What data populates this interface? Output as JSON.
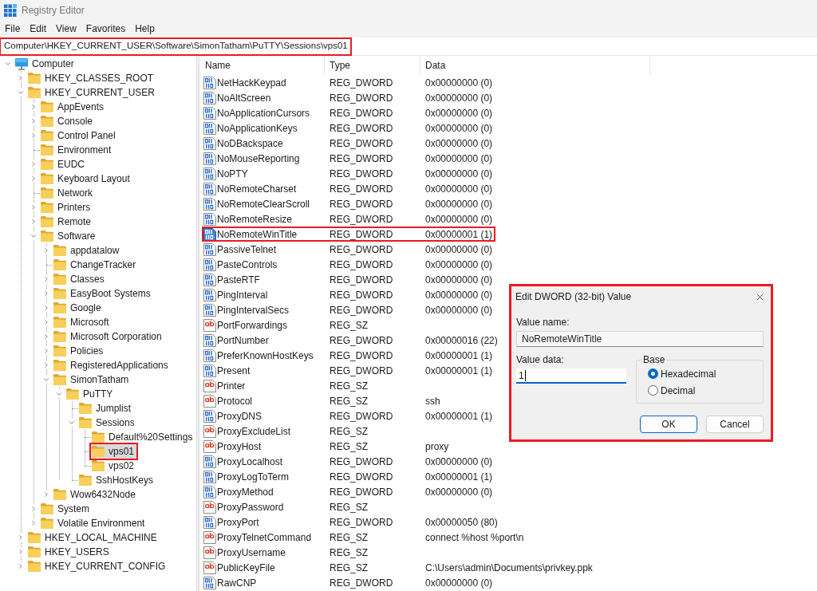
{
  "window": {
    "title": "Registry Editor"
  },
  "menu": [
    "File",
    "Edit",
    "View",
    "Favorites",
    "Help"
  ],
  "address_bar": {
    "path": "Computer\\HKEY_CURRENT_USER\\Software\\SimonTatham\\PuTTY\\Sessions\\vps01",
    "highlighted": true
  },
  "tree": {
    "root": {
      "label": "Computer",
      "kind": "expanded",
      "selected": false,
      "highlighted": false,
      "children": [
        {
          "label": "HKEY_CLASSES_ROOT",
          "kind": "collapsed",
          "selected": false,
          "highlighted": false
        },
        {
          "label": "HKEY_CURRENT_USER",
          "kind": "expanded",
          "selected": false,
          "highlighted": false,
          "children": [
            {
              "label": "AppEvents",
              "kind": "collapsed",
              "selected": false,
              "highlighted": false
            },
            {
              "label": "Console",
              "kind": "collapsed",
              "selected": false,
              "highlighted": false
            },
            {
              "label": "Control Panel",
              "kind": "collapsed",
              "selected": false,
              "highlighted": false
            },
            {
              "label": "Environment",
              "kind": "leaf",
              "selected": false,
              "highlighted": false
            },
            {
              "label": "EUDC",
              "kind": "collapsed",
              "selected": false,
              "highlighted": false
            },
            {
              "label": "Keyboard Layout",
              "kind": "collapsed",
              "selected": false,
              "highlighted": false
            },
            {
              "label": "Network",
              "kind": "leaf",
              "selected": false,
              "highlighted": false
            },
            {
              "label": "Printers",
              "kind": "collapsed",
              "selected": false,
              "highlighted": false
            },
            {
              "label": "Remote",
              "kind": "collapsed",
              "selected": false,
              "highlighted": false
            },
            {
              "label": "Software",
              "kind": "expanded",
              "selected": false,
              "highlighted": false,
              "children": [
                {
                  "label": "appdatalow",
                  "kind": "collapsed",
                  "selected": false,
                  "highlighted": false
                },
                {
                  "label": "ChangeTracker",
                  "kind": "leaf",
                  "selected": false,
                  "highlighted": false
                },
                {
                  "label": "Classes",
                  "kind": "collapsed",
                  "selected": false,
                  "highlighted": false
                },
                {
                  "label": "EasyBoot Systems",
                  "kind": "collapsed",
                  "selected": false,
                  "highlighted": false
                },
                {
                  "label": "Google",
                  "kind": "collapsed",
                  "selected": false,
                  "highlighted": false
                },
                {
                  "label": "Microsoft",
                  "kind": "collapsed",
                  "selected": false,
                  "highlighted": false
                },
                {
                  "label": "Microsoft Corporation",
                  "kind": "collapsed",
                  "selected": false,
                  "highlighted": false
                },
                {
                  "label": "Policies",
                  "kind": "collapsed",
                  "selected": false,
                  "highlighted": false
                },
                {
                  "label": "RegisteredApplications",
                  "kind": "collapsed",
                  "selected": false,
                  "highlighted": false
                },
                {
                  "label": "SimonTatham",
                  "kind": "expanded",
                  "selected": false,
                  "highlighted": false,
                  "children": [
                    {
                      "label": "PuTTY",
                      "kind": "expanded",
                      "selected": false,
                      "highlighted": false,
                      "children": [
                        {
                          "label": "Jumplist",
                          "kind": "leaf",
                          "selected": false,
                          "highlighted": false
                        },
                        {
                          "label": "Sessions",
                          "kind": "expanded",
                          "selected": false,
                          "highlighted": false,
                          "children": [
                            {
                              "label": "Default%20Settings",
                              "kind": "leaf",
                              "selected": false,
                              "highlighted": false
                            },
                            {
                              "label": "vps01",
                              "kind": "leaf",
                              "selected": true,
                              "highlighted": true
                            },
                            {
                              "label": "vps02",
                              "kind": "leaf",
                              "selected": false,
                              "highlighted": false
                            }
                          ]
                        },
                        {
                          "label": "SshHostKeys",
                          "kind": "leaf",
                          "selected": false,
                          "highlighted": false
                        }
                      ]
                    }
                  ]
                },
                {
                  "label": "Wow6432Node",
                  "kind": "collapsed",
                  "selected": false,
                  "highlighted": false
                }
              ]
            },
            {
              "label": "System",
              "kind": "collapsed",
              "selected": false,
              "highlighted": false
            },
            {
              "label": "Volatile Environment",
              "kind": "collapsed",
              "selected": false,
              "highlighted": false
            }
          ]
        },
        {
          "label": "HKEY_LOCAL_MACHINE",
          "kind": "collapsed",
          "selected": false,
          "highlighted": false
        },
        {
          "label": "HKEY_USERS",
          "kind": "collapsed",
          "selected": false,
          "highlighted": false
        },
        {
          "label": "HKEY_CURRENT_CONFIG",
          "kind": "collapsed",
          "selected": false,
          "highlighted": false
        }
      ]
    }
  },
  "list": {
    "columns": [
      "Name",
      "Type",
      "Data"
    ],
    "rows": [
      {
        "kind": "dword",
        "name": "NetHackKeypad",
        "type": "REG_DWORD",
        "data": "0x00000000 (0)",
        "selected": false,
        "highlighted": false
      },
      {
        "kind": "dword",
        "name": "NoAltScreen",
        "type": "REG_DWORD",
        "data": "0x00000000 (0)",
        "selected": false,
        "highlighted": false
      },
      {
        "kind": "dword",
        "name": "NoApplicationCursors",
        "type": "REG_DWORD",
        "data": "0x00000000 (0)",
        "selected": false,
        "highlighted": false
      },
      {
        "kind": "dword",
        "name": "NoApplicationKeys",
        "type": "REG_DWORD",
        "data": "0x00000000 (0)",
        "selected": false,
        "highlighted": false
      },
      {
        "kind": "dword",
        "name": "NoDBackspace",
        "type": "REG_DWORD",
        "data": "0x00000000 (0)",
        "selected": false,
        "highlighted": false
      },
      {
        "kind": "dword",
        "name": "NoMouseReporting",
        "type": "REG_DWORD",
        "data": "0x00000000 (0)",
        "selected": false,
        "highlighted": false
      },
      {
        "kind": "dword",
        "name": "NoPTY",
        "type": "REG_DWORD",
        "data": "0x00000000 (0)",
        "selected": false,
        "highlighted": false
      },
      {
        "kind": "dword",
        "name": "NoRemoteCharset",
        "type": "REG_DWORD",
        "data": "0x00000000 (0)",
        "selected": false,
        "highlighted": false
      },
      {
        "kind": "dword",
        "name": "NoRemoteClearScroll",
        "type": "REG_DWORD",
        "data": "0x00000000 (0)",
        "selected": false,
        "highlighted": false
      },
      {
        "kind": "dword",
        "name": "NoRemoteResize",
        "type": "REG_DWORD",
        "data": "0x00000000 (0)",
        "selected": false,
        "highlighted": false
      },
      {
        "kind": "dword",
        "name": "NoRemoteWinTitle",
        "type": "REG_DWORD",
        "data": "0x00000001 (1)",
        "selected": true,
        "highlighted": true
      },
      {
        "kind": "dword",
        "name": "PassiveTelnet",
        "type": "REG_DWORD",
        "data": "0x00000000 (0)",
        "selected": false,
        "highlighted": false
      },
      {
        "kind": "dword",
        "name": "PasteControls",
        "type": "REG_DWORD",
        "data": "0x00000000 (0)",
        "selected": false,
        "highlighted": false
      },
      {
        "kind": "dword",
        "name": "PasteRTF",
        "type": "REG_DWORD",
        "data": "0x00000000 (0)",
        "selected": false,
        "highlighted": false
      },
      {
        "kind": "dword",
        "name": "PingInterval",
        "type": "REG_DWORD",
        "data": "0x00000000 (0)",
        "selected": false,
        "highlighted": false
      },
      {
        "kind": "dword",
        "name": "PingIntervalSecs",
        "type": "REG_DWORD",
        "data": "0x00000000 (0)",
        "selected": false,
        "highlighted": false
      },
      {
        "kind": "string",
        "name": "PortForwardings",
        "type": "REG_SZ",
        "selected": false,
        "highlighted": false
      },
      {
        "kind": "dword",
        "name": "PortNumber",
        "type": "REG_DWORD",
        "data": "0x00000016 (22)",
        "selected": false,
        "highlighted": false
      },
      {
        "kind": "dword",
        "name": "PreferKnownHostKeys",
        "type": "REG_DWORD",
        "data": "0x00000001 (1)",
        "selected": false,
        "highlighted": false
      },
      {
        "kind": "dword",
        "name": "Present",
        "type": "REG_DWORD",
        "data": "0x00000001 (1)",
        "selected": false,
        "highlighted": false
      },
      {
        "kind": "string",
        "name": "Printer",
        "type": "REG_SZ",
        "selected": false,
        "highlighted": false
      },
      {
        "kind": "string",
        "name": "Protocol",
        "type": "REG_SZ",
        "data": "ssh",
        "selected": false,
        "highlighted": false
      },
      {
        "kind": "dword",
        "name": "ProxyDNS",
        "type": "REG_DWORD",
        "data": "0x00000001 (1)",
        "selected": false,
        "highlighted": false
      },
      {
        "kind": "string",
        "name": "ProxyExcludeList",
        "type": "REG_SZ",
        "selected": false,
        "highlighted": false
      },
      {
        "kind": "string",
        "name": "ProxyHost",
        "type": "REG_SZ",
        "data": "proxy",
        "selected": false,
        "highlighted": false
      },
      {
        "kind": "dword",
        "name": "ProxyLocalhost",
        "type": "REG_DWORD",
        "data": "0x00000000 (0)",
        "selected": false,
        "highlighted": false
      },
      {
        "kind": "dword",
        "name": "ProxyLogToTerm",
        "type": "REG_DWORD",
        "data": "0x00000001 (1)",
        "selected": false,
        "highlighted": false
      },
      {
        "kind": "dword",
        "name": "ProxyMethod",
        "type": "REG_DWORD",
        "data": "0x00000000 (0)",
        "selected": false,
        "highlighted": false
      },
      {
        "kind": "string",
        "name": "ProxyPassword",
        "type": "REG_SZ",
        "selected": false,
        "highlighted": false
      },
      {
        "kind": "dword",
        "name": "ProxyPort",
        "type": "REG_DWORD",
        "data": "0x00000050 (80)",
        "selected": false,
        "highlighted": false
      },
      {
        "kind": "string",
        "name": "ProxyTelnetCommand",
        "type": "REG_SZ",
        "data": "connect %host %port\\n",
        "selected": false,
        "highlighted": false
      },
      {
        "kind": "string",
        "name": "ProxyUsername",
        "type": "REG_SZ",
        "selected": false,
        "highlighted": false
      },
      {
        "kind": "string",
        "name": "PublicKeyFile",
        "type": "REG_SZ",
        "data": "C:\\Users\\admin\\Documents\\privkey.ppk",
        "selected": false,
        "highlighted": false
      },
      {
        "kind": "dword",
        "name": "RawCNP",
        "type": "REG_DWORD",
        "data": "0x00000000 (0)",
        "selected": false,
        "highlighted": false
      }
    ]
  },
  "dialog": {
    "title": "Edit DWORD (32-bit) Value",
    "highlighted": true,
    "value_name": {
      "label": "Value name:",
      "value": "NoRemoteWinTitle"
    },
    "value_data": {
      "label": "Value data:",
      "value": "1",
      "focused": true
    },
    "base": {
      "label": "Base",
      "options": [
        {
          "label": "Hexadecimal",
          "selected": true
        },
        {
          "label": "Decimal",
          "selected": false
        }
      ]
    },
    "buttons": [
      {
        "label": "OK",
        "focused": true
      },
      {
        "label": "Cancel",
        "focused": false
      }
    ]
  }
}
